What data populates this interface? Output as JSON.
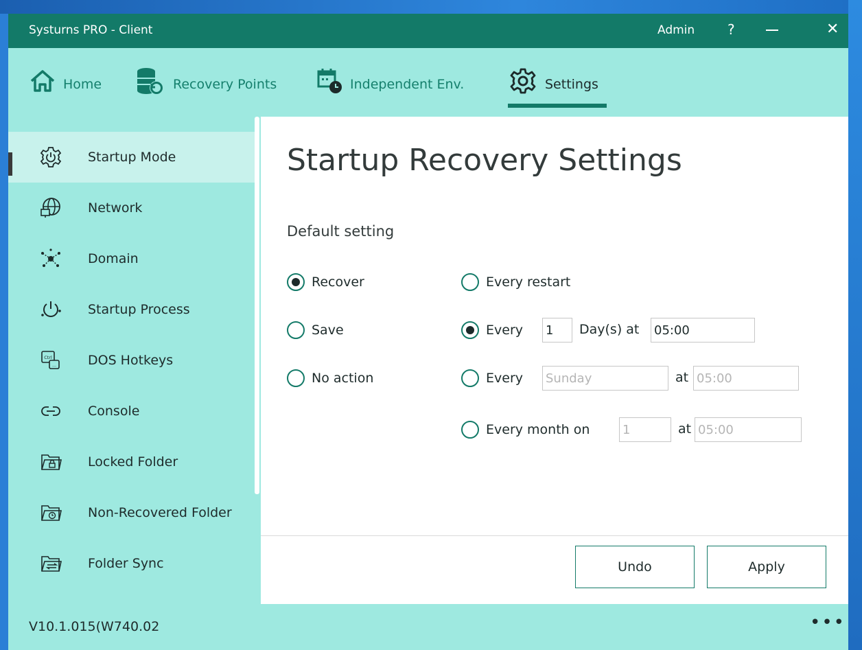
{
  "window": {
    "title": "Systurns PRO - Client",
    "user": "Admin",
    "help_label": "?",
    "close_label": "✕"
  },
  "nav": {
    "tabs": [
      {
        "label": "Home",
        "icon": "home-icon"
      },
      {
        "label": "Recovery Points",
        "icon": "database-restore-icon"
      },
      {
        "label": "Independent Env.",
        "icon": "calendar-clock-icon"
      },
      {
        "label": "Settings",
        "icon": "gear-icon",
        "active": true
      }
    ]
  },
  "sidebar": {
    "items": [
      {
        "label": "Startup Mode",
        "icon": "power-gear-icon",
        "active": true
      },
      {
        "label": "Network",
        "icon": "globe-monitor-icon"
      },
      {
        "label": "Domain",
        "icon": "network-node-icon"
      },
      {
        "label": "Startup Process",
        "icon": "power-dots-icon"
      },
      {
        "label": "DOS Hotkeys",
        "icon": "ctrl-key-icon"
      },
      {
        "label": "Console",
        "icon": "link-icon"
      },
      {
        "label": "Locked Folder",
        "icon": "folder-lock-icon"
      },
      {
        "label": "Non-Recovered Folder",
        "icon": "folder-clock-icon"
      },
      {
        "label": "Folder Sync",
        "icon": "folder-sync-icon"
      }
    ]
  },
  "main": {
    "title": "Startup Recovery Settings",
    "section_label": "Default setting",
    "actions": [
      {
        "label": "Recover",
        "checked": true
      },
      {
        "label": "Save",
        "checked": false
      },
      {
        "label": "No action",
        "checked": false
      }
    ],
    "schedule": {
      "every_restart": {
        "label": "Every restart",
        "checked": false
      },
      "daily": {
        "label": "Every",
        "days": "1",
        "unit": "Day(s) at",
        "time": "05:00",
        "checked": true
      },
      "weekly": {
        "label": "Every",
        "weekday": "Sunday",
        "at": "at",
        "time": "05:00",
        "checked": false
      },
      "monthly": {
        "label": "Every month on",
        "day": "1",
        "at": "at",
        "time": "05:00",
        "checked": false
      }
    },
    "buttons": {
      "undo": "Undo",
      "apply": "Apply"
    }
  },
  "status": {
    "version": "V10.1.015(W740.02",
    "more_label": "•••"
  },
  "colors": {
    "primary": "#137a68",
    "nav_bg": "#9ee9e0",
    "active_item_bg": "#c8f2ec"
  }
}
